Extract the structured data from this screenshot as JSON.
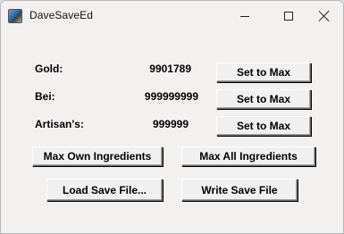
{
  "window": {
    "title": "DaveSaveEd",
    "controls": {
      "minimize": "minimize-icon",
      "maximize": "maximize-icon",
      "close": "close-icon"
    }
  },
  "fields": [
    {
      "label": "Gold:",
      "value": "9901789",
      "button": "Set to Max"
    },
    {
      "label": "Bei:",
      "value": "999999999",
      "button": "Set to Max"
    },
    {
      "label": "Artisan's:",
      "value": "999999",
      "button": "Set to Max"
    }
  ],
  "actions": {
    "max_own_ingredients": "Max Own Ingredients",
    "max_all_ingredients": "Max All Ingredients",
    "load_save_file": "Load Save File...",
    "write_save_file": "Write Save File"
  }
}
